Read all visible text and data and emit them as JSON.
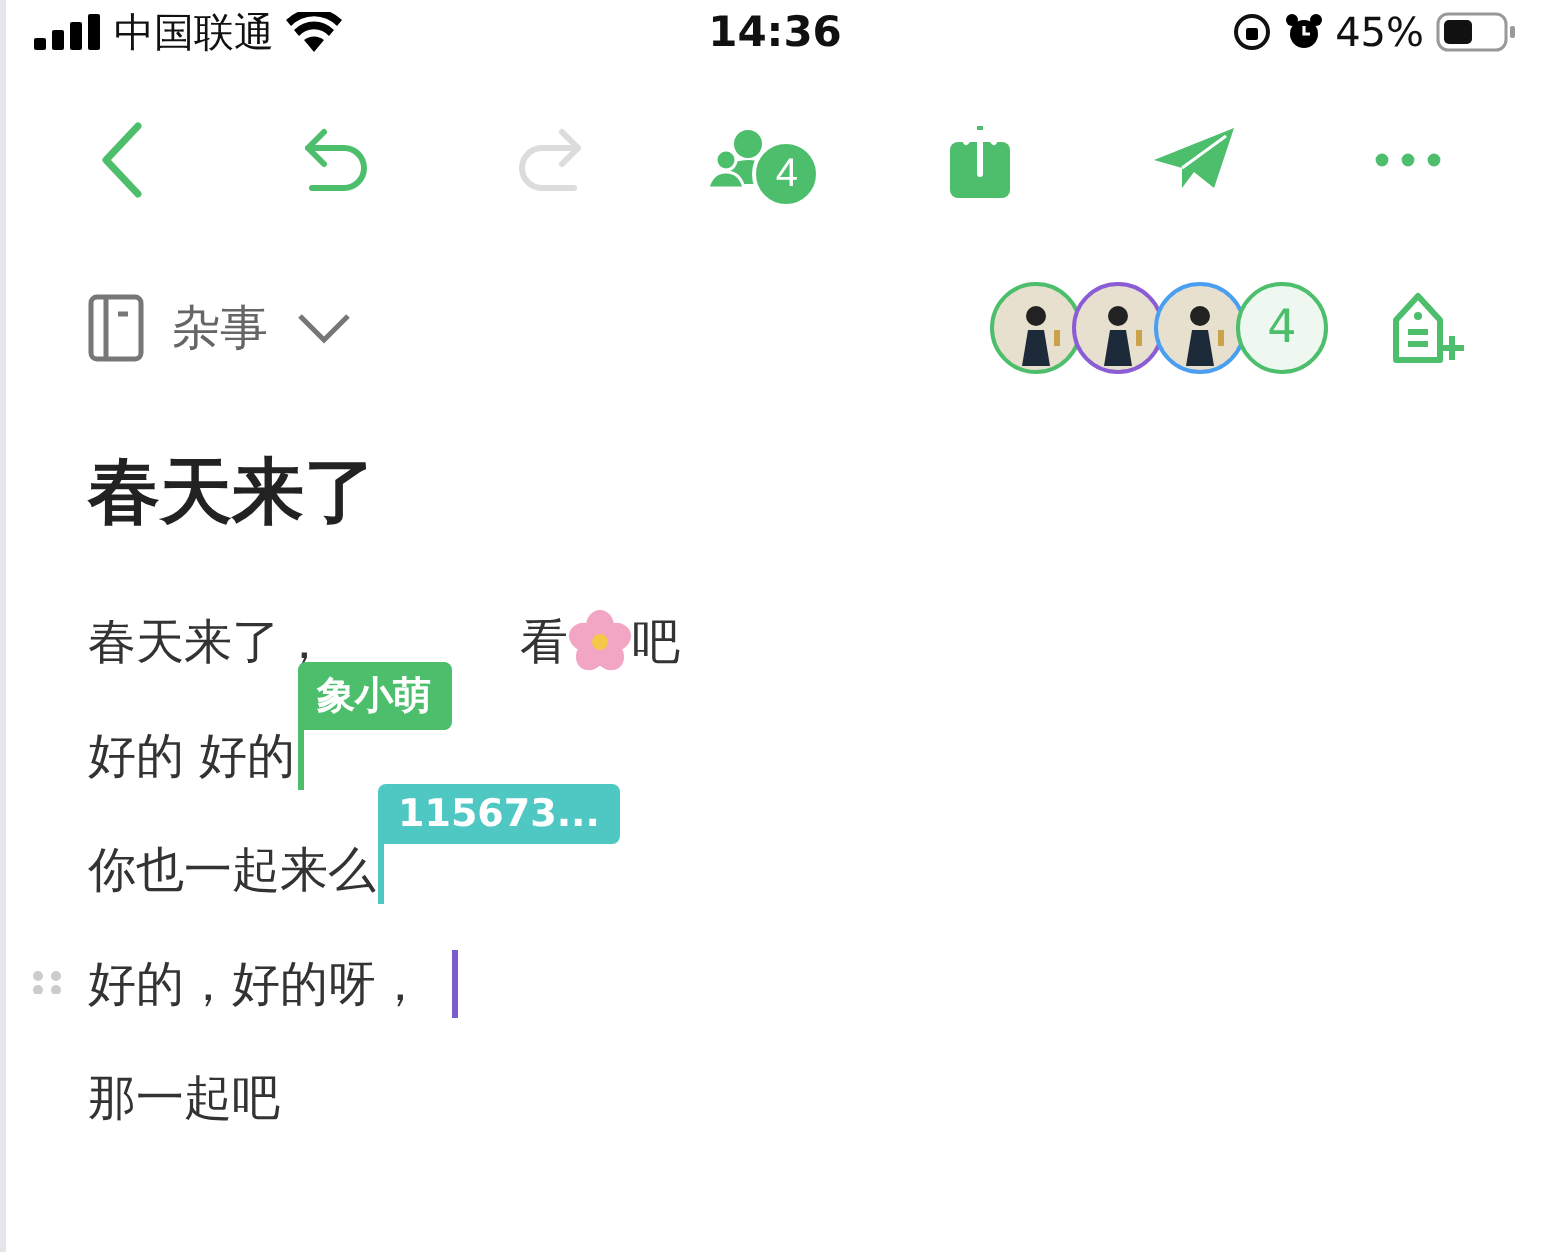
{
  "status_bar": {
    "carrier": "中国联通",
    "time": "14:36",
    "battery": "45%"
  },
  "toolbar": {
    "buttons": [
      {
        "kind": "back",
        "disabled": false
      },
      {
        "kind": "undo",
        "disabled": false
      },
      {
        "kind": "redo",
        "disabled": true
      },
      {
        "kind": "members",
        "disabled": false,
        "badge": "4"
      },
      {
        "kind": "share",
        "disabled": false
      },
      {
        "kind": "send",
        "disabled": false
      },
      {
        "kind": "more",
        "disabled": false
      }
    ]
  },
  "notebook": {
    "name": "杂事"
  },
  "collaborators": {
    "avatars": [
      {
        "color": "#4cbe6c"
      },
      {
        "color": "#8a5cd6"
      },
      {
        "color": "#4a9ff0"
      }
    ],
    "count": "4"
  },
  "title": "春天来了",
  "lines": [
    {
      "segments": [
        {
          "kind": "text",
          "text": "春天来了，"
        },
        {
          "kind": "covered"
        },
        {
          "kind": "text",
          "text": "看"
        },
        {
          "kind": "flower"
        },
        {
          "kind": "text",
          "text": "吧"
        }
      ]
    },
    {
      "segments": [
        {
          "kind": "text",
          "text": "好的 好的"
        }
      ],
      "cursor": {
        "color": "#4cbe6c",
        "label": "象小萌"
      }
    },
    {
      "segments": [
        {
          "kind": "text",
          "text": "你也一起来么"
        }
      ],
      "cursor": {
        "color": "#4fc8c4",
        "label": "115673..."
      }
    },
    {
      "segments": [
        {
          "kind": "text",
          "text": "好的，好的呀，"
        }
      ],
      "handle": true,
      "cursor": {
        "color": "#7a5cd0"
      }
    },
    {
      "segments": [
        {
          "kind": "text",
          "text": "那一起吧"
        }
      ]
    }
  ]
}
